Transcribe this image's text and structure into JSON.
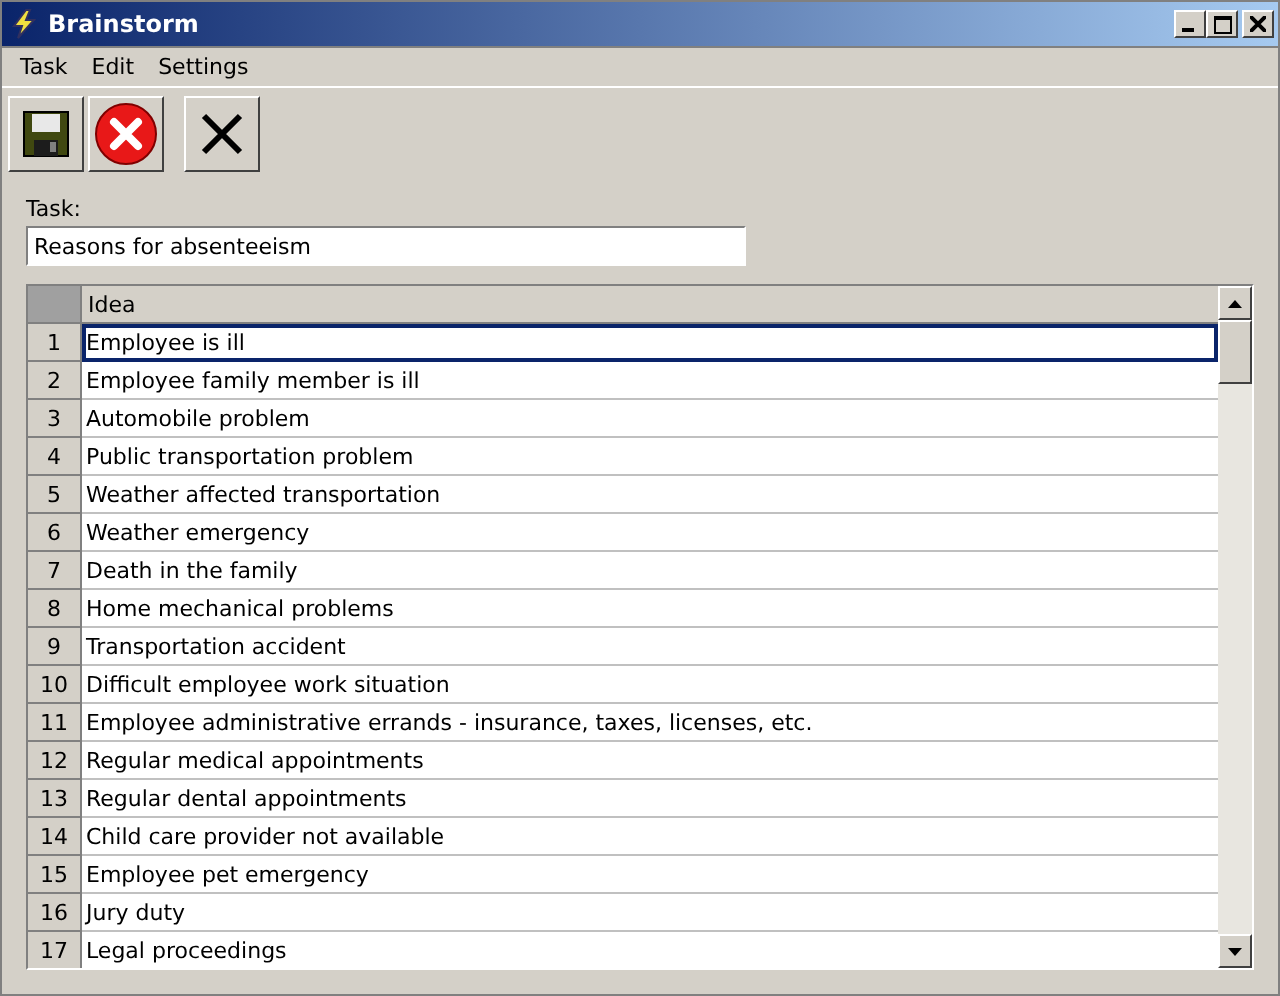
{
  "window": {
    "title": "Brainstorm"
  },
  "menu": [
    "Task",
    "Edit",
    "Settings"
  ],
  "task": {
    "label": "Task:",
    "value": "Reasons for absenteeism"
  },
  "table": {
    "columns": [
      "Idea"
    ],
    "rows": [
      {
        "number": "1",
        "idea": "Employee is ill",
        "selected": true
      },
      {
        "number": "2",
        "idea": "Employee family member is ill",
        "selected": false
      },
      {
        "number": "3",
        "idea": "Automobile problem",
        "selected": false
      },
      {
        "number": "4",
        "idea": "Public transportation problem",
        "selected": false
      },
      {
        "number": "5",
        "idea": "Weather affected transportation",
        "selected": false
      },
      {
        "number": "6",
        "idea": "Weather emergency",
        "selected": false
      },
      {
        "number": "7",
        "idea": "Death in the family",
        "selected": false
      },
      {
        "number": "8",
        "idea": "Home mechanical problems",
        "selected": false
      },
      {
        "number": "9",
        "idea": "Transportation accident",
        "selected": false
      },
      {
        "number": "10",
        "idea": "Difficult employee work situation",
        "selected": false
      },
      {
        "number": "11",
        "idea": "Employee administrative errands - insurance, taxes, licenses, etc.",
        "selected": false
      },
      {
        "number": "12",
        "idea": "Regular medical appointments",
        "selected": false
      },
      {
        "number": "13",
        "idea": "Regular dental appointments",
        "selected": false
      },
      {
        "number": "14",
        "idea": "Child care provider not available",
        "selected": false
      },
      {
        "number": "15",
        "idea": "Employee pet emergency",
        "selected": false
      },
      {
        "number": "16",
        "idea": "Jury duty",
        "selected": false
      },
      {
        "number": "17",
        "idea": "Legal proceedings",
        "selected": false
      }
    ]
  }
}
